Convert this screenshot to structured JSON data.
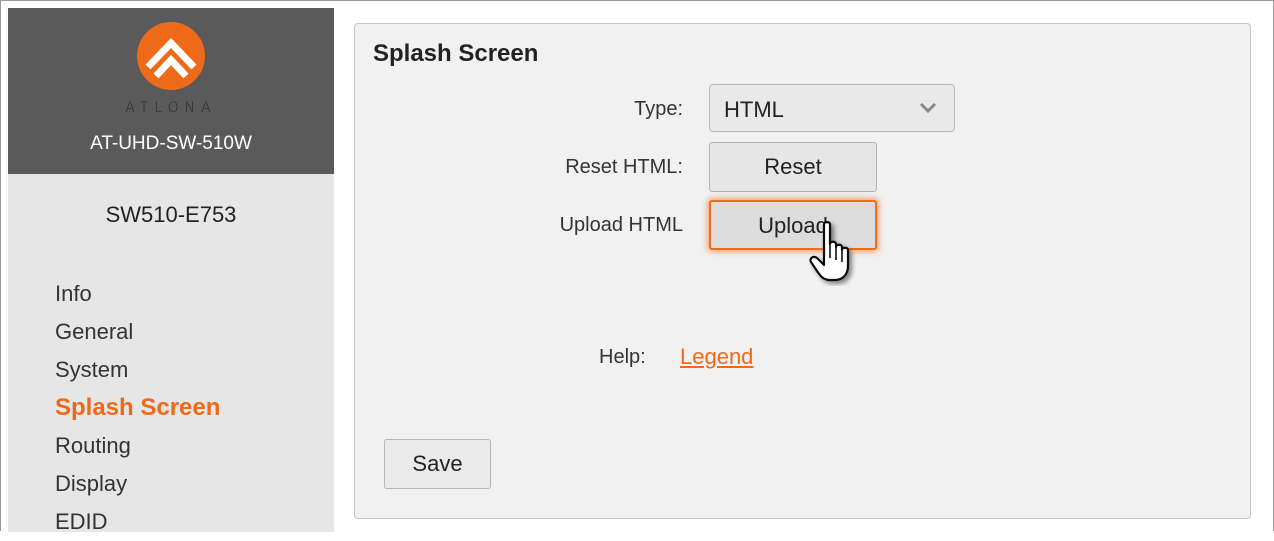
{
  "brand": {
    "logo_text": "ATLONA",
    "model": "AT-UHD-SW-510W",
    "hostname": "SW510-E753",
    "accent_color": "#ee6a19"
  },
  "nav": {
    "items": [
      {
        "label": "Info",
        "active": false
      },
      {
        "label": "General",
        "active": false
      },
      {
        "label": "System",
        "active": false
      },
      {
        "label": "Splash Screen",
        "active": true
      },
      {
        "label": "Routing",
        "active": false
      },
      {
        "label": "Display",
        "active": false
      },
      {
        "label": "EDID",
        "active": false
      }
    ]
  },
  "panel": {
    "title": "Splash Screen",
    "type_label": "Type:",
    "type_value": "HTML",
    "reset_label": "Reset HTML:",
    "reset_button": "Reset",
    "upload_label": "Upload HTML",
    "upload_button": "Upload",
    "help_label": "Help:",
    "help_link": "Legend",
    "save_button": "Save"
  },
  "icons": {
    "logo": "atlona-logo-icon",
    "select_arrow": "chevron-down-icon",
    "pointer": "hand-pointer-icon"
  }
}
